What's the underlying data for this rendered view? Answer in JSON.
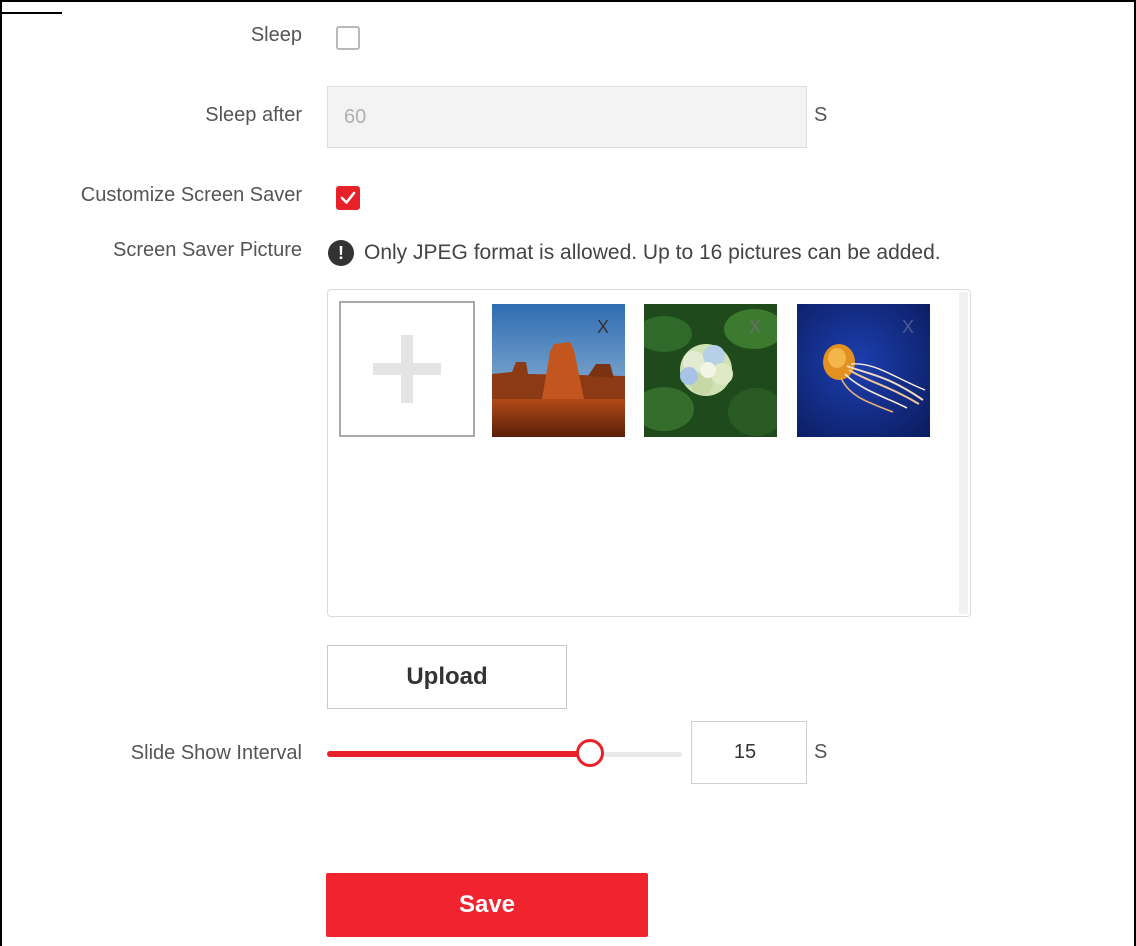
{
  "sleep": {
    "label": "Sleep",
    "checked": false
  },
  "sleep_after": {
    "label": "Sleep after",
    "value": "60",
    "unit": "S"
  },
  "customize_screen_saver": {
    "label": "Customize Screen Saver",
    "checked": true
  },
  "screen_saver_picture": {
    "label": "Screen Saver Picture",
    "info_icon": "exclamation-icon",
    "hint": "Only JPEG format is allowed. Up to 16 pictures can be added.",
    "add_icon": "plus-icon",
    "pictures": [
      {
        "name": "desert-butte",
        "remove_label": "X"
      },
      {
        "name": "hydrangea-flower",
        "remove_label": "X"
      },
      {
        "name": "jellyfish",
        "remove_label": "X"
      }
    ]
  },
  "upload_button": "Upload",
  "slide_show_interval": {
    "label": "Slide Show Interval",
    "value": "15",
    "unit": "S",
    "slider_fraction": 0.74
  },
  "save_button": "Save",
  "colors": {
    "accent": "#e8202a",
    "save": "#f0232e",
    "text": "#555555",
    "disabled_bg": "#f3f3f3"
  }
}
